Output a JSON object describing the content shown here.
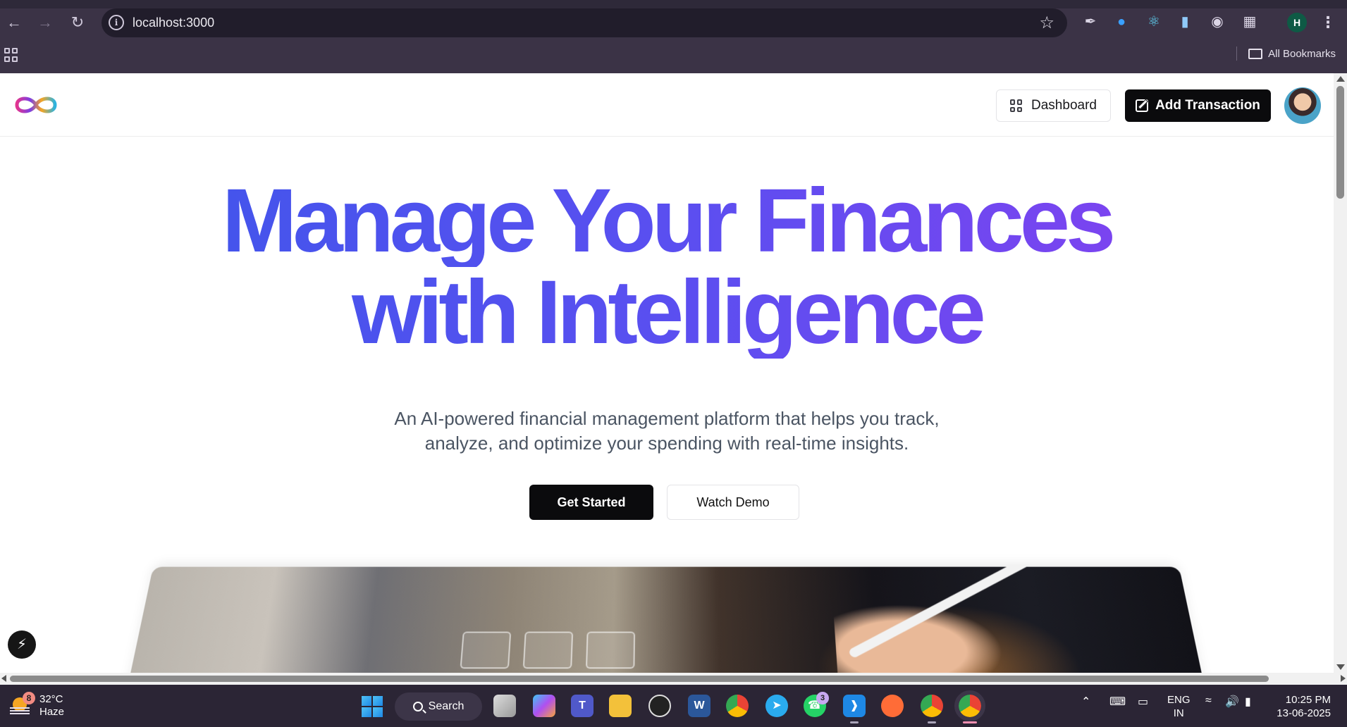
{
  "browser": {
    "url": "localhost:3000",
    "bookmarks_label": "All Bookmarks",
    "profile_initial": "H"
  },
  "app": {
    "dashboard_label": "Dashboard",
    "add_transaction_label": "Add Transaction"
  },
  "hero": {
    "title_line1": "Manage Your Finances",
    "title_line2": "with Intelligence",
    "subtitle_line1": "An AI-powered financial management platform that helps you track,",
    "subtitle_line2": "analyze, and optimize your spending with real-time insights.",
    "get_started_label": "Get Started",
    "watch_demo_label": "Watch Demo"
  },
  "taskbar": {
    "weather_temp": "32°C",
    "weather_desc": "Haze",
    "weather_badge": "8",
    "search_label": "Search",
    "whatsapp_badge": "3",
    "lang_line1": "ENG",
    "lang_line2": "IN",
    "time": "10:25 PM",
    "date": "13-06-2025"
  },
  "colors": {
    "gradient_start": "#3a57ea",
    "gradient_end": "#8a3ff0",
    "primary_button": "#0b0b0d"
  }
}
